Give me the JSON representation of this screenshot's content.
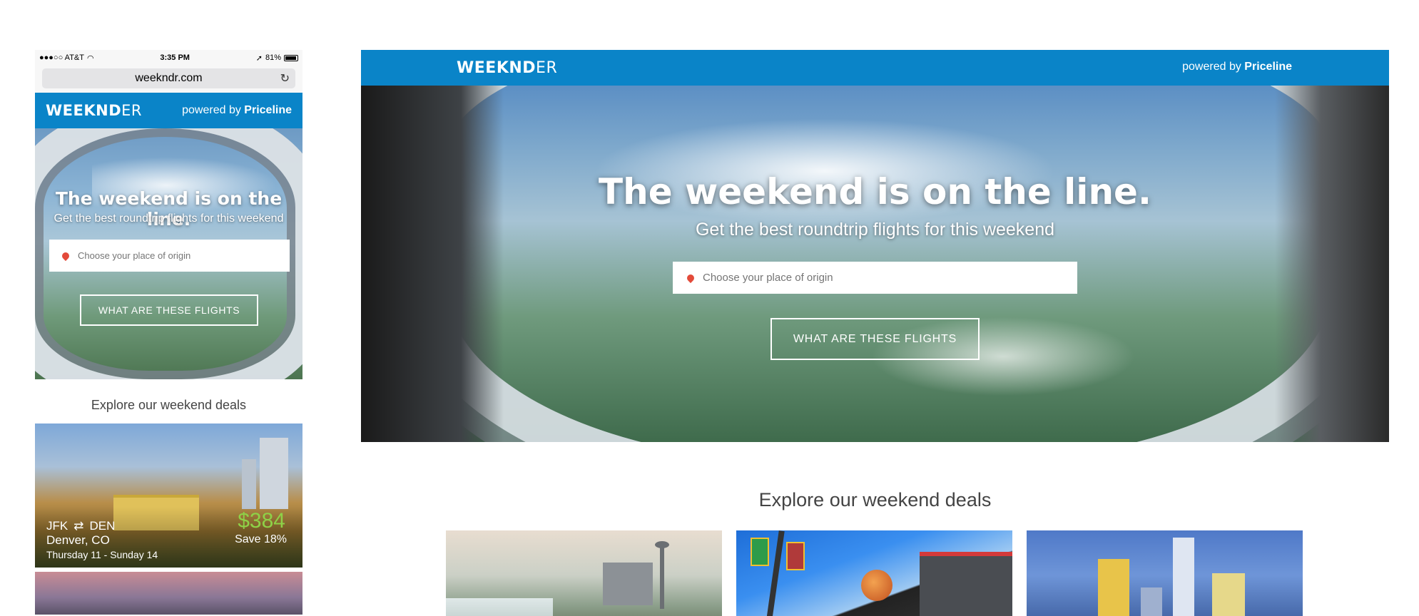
{
  "mobile": {
    "status_bar": {
      "carrier": "●●●○○ AT&T",
      "time": "3:35 PM",
      "battery": "81%"
    },
    "url": "weekndr.com",
    "header": {
      "logo_bold": "WEEKND",
      "logo_light": "ER",
      "powered_by": "powered by",
      "brand": "Priceline"
    },
    "hero": {
      "title": "The weekend is on the line.",
      "subtitle": "Get the best roundtrip flights for this weekend",
      "search_placeholder": "Choose your place of origin",
      "button_label": "WHAT ARE THESE FLIGHTS"
    },
    "explore_title": "Explore our weekend deals",
    "deal": {
      "origin": "JFK",
      "destination": "DEN",
      "city": "Denver, CO",
      "dates": "Thursday 11 - Sunday 14",
      "price": "$384",
      "savings": "Save 18%"
    }
  },
  "desktop": {
    "header": {
      "logo_bold": "WEEKND",
      "logo_light": "ER",
      "powered_by": "powered by",
      "brand": "Priceline"
    },
    "hero": {
      "title": "The weekend is on the line.",
      "subtitle": "Get the best roundtrip flights for this weekend",
      "search_placeholder": "Choose your place of origin",
      "button_label": "WHAT ARE THESE FLIGHTS"
    },
    "explore_title": "Explore our weekend deals"
  },
  "colors": {
    "brand_blue": "#0a84c8",
    "price_green": "#8ed147",
    "pin_red": "#e34a3a"
  }
}
